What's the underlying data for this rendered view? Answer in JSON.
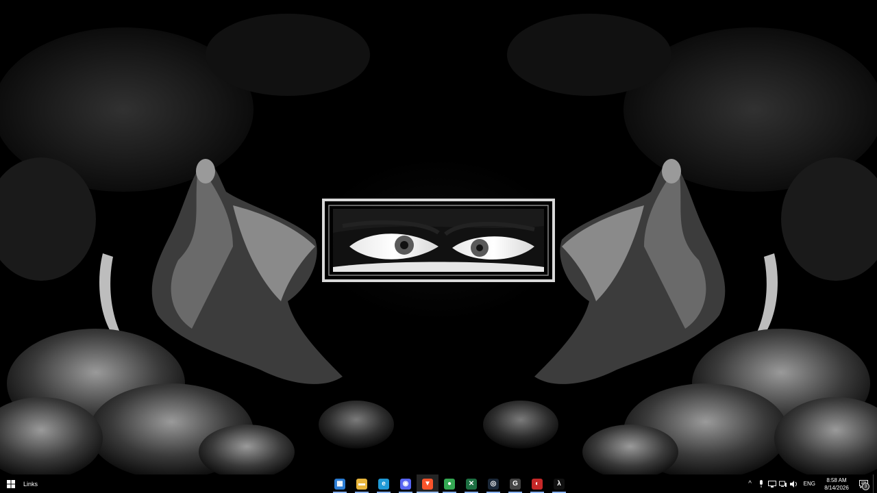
{
  "taskbar": {
    "toolbar_label": "Links",
    "apps": [
      {
        "name": "microsoft-store",
        "glyph": "▦",
        "color": "#2b7cd3"
      },
      {
        "name": "file-explorer",
        "glyph": "▬",
        "color": "#e8b53b"
      },
      {
        "name": "edge",
        "glyph": "e",
        "color": "#1f9ad6"
      },
      {
        "name": "discord",
        "glyph": "◉",
        "color": "#5865f2"
      },
      {
        "name": "brave",
        "glyph": "▼",
        "color": "#fb542b"
      },
      {
        "name": "chrome",
        "glyph": "●",
        "color": "#34a853"
      },
      {
        "name": "excel-like",
        "glyph": "✕",
        "color": "#1d6f42"
      },
      {
        "name": "steam",
        "glyph": "◎",
        "color": "#1b2838"
      },
      {
        "name": "epic-g",
        "glyph": "G",
        "color": "#444444"
      },
      {
        "name": "red-app",
        "glyph": "◐",
        "color": "#c62828"
      },
      {
        "name": "lambda-app",
        "glyph": "λ",
        "color": "#111111"
      }
    ],
    "tray": {
      "language": "ENG",
      "time": "8:58 AM",
      "date": "8/14/2026",
      "notification_count": "3"
    }
  },
  "colors": {
    "taskbar_bg": "#000000",
    "accent": "#8ab4f8"
  }
}
